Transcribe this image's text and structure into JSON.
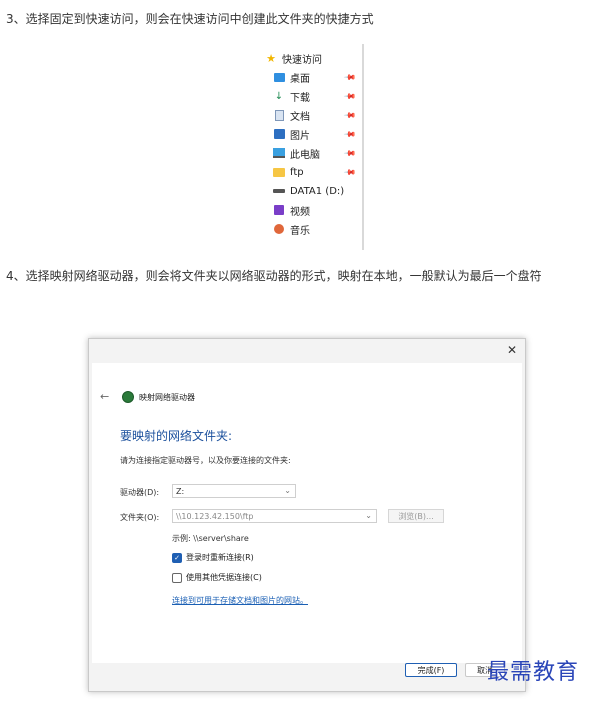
{
  "step3": "3、选择固定到快速访问，则会在快速访问中创建此文件夹的快捷方式",
  "step4": "4、选择映射网络驱动器，则会将文件夹以网络驱动器的形式，映射在本地，一般默认为最后一个盘符",
  "quick_access": {
    "title": "快速访问",
    "items": [
      {
        "label": "桌面",
        "icon": "desktop-icon",
        "pinned": true
      },
      {
        "label": "下载",
        "icon": "download-icon",
        "pinned": true
      },
      {
        "label": "文档",
        "icon": "document-icon",
        "pinned": true
      },
      {
        "label": "图片",
        "icon": "picture-icon",
        "pinned": true
      },
      {
        "label": "此电脑",
        "icon": "computer-icon",
        "pinned": true
      },
      {
        "label": "ftp",
        "icon": "folder-icon",
        "pinned": true
      },
      {
        "label": "DATA1 (D:)",
        "icon": "drive-icon",
        "pinned": false
      },
      {
        "label": "视频",
        "icon": "video-icon",
        "pinned": false
      },
      {
        "label": "音乐",
        "icon": "music-icon",
        "pinned": false
      }
    ]
  },
  "dialog": {
    "title": "映射网络驱动器",
    "heading": "要映射的网络文件夹:",
    "subheading": "请为连接指定驱动器号，以及你要连接的文件夹:",
    "drive_label": "驱动器(D):",
    "drive_value": "Z:",
    "folder_label": "文件夹(O):",
    "folder_value": "\\\\10.123.42.150\\ftp",
    "browse_label": "浏览(B)...",
    "example": "示例: \\\\server\\share",
    "reconnect_label": "登录时重新连接(R)",
    "reconnect_checked": true,
    "other_cred_label": "使用其他凭据连接(C)",
    "other_cred_checked": false,
    "link": "连接到可用于存储文档和图片的网站。",
    "finish_label": "完成(F)",
    "cancel_label": "取消"
  },
  "watermark": "最需教育",
  "colors": {
    "accent": "#1f5fb3",
    "heading": "#1a4f9c",
    "watermark": "#2a45b8"
  }
}
